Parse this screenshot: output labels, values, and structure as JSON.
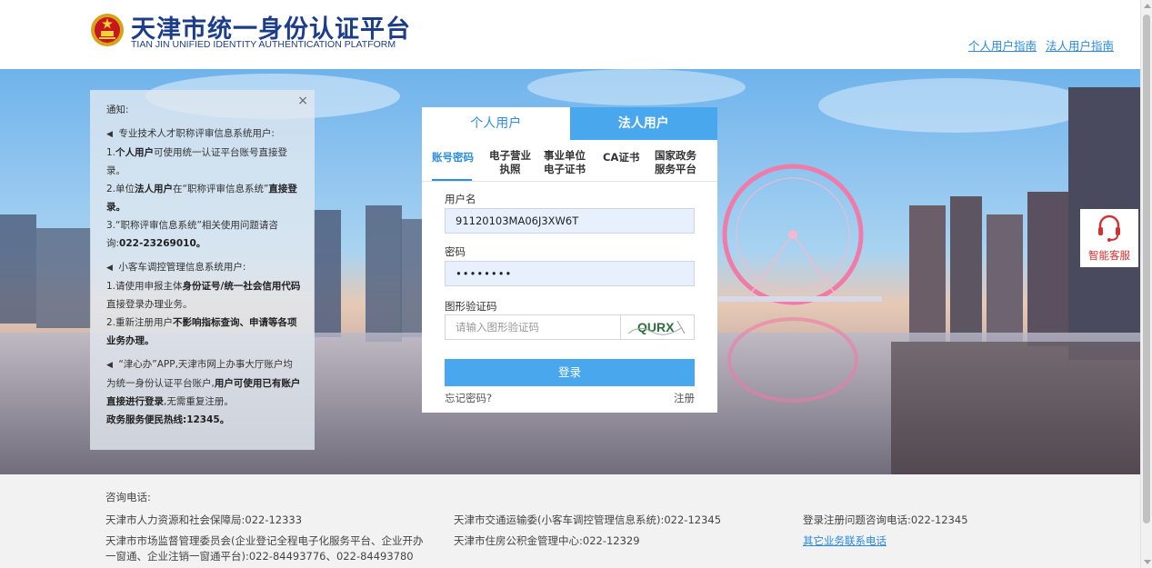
{
  "header": {
    "title_cn": "天津市统一身份认证平台",
    "title_en": "TIAN JIN UNIFIED IDENTITY AUTHENTICATION PLATFORM",
    "links": [
      "个人用户指南",
      "法人用户指南"
    ]
  },
  "notice": {
    "close": "×",
    "title": "通知:",
    "s1_head": "专业技术人才职称评审信息系统用户:",
    "s1_l1a": "1.",
    "s1_l1b": "个人用户",
    "s1_l1c": "可使用统一认证平台账号直接登录。",
    "s1_l2a": "2.单位",
    "s1_l2b": "法人用户",
    "s1_l2c": "在“职称评审信息系统”",
    "s1_l2d": "直接登录。",
    "s1_l3a": "3.“职称评审信息系统”相关使用问题请咨询:",
    "s1_l3b": "022-23269010。",
    "s2_head": "小客车调控管理信息系统用户:",
    "s2_l1a": "1.请使用申报主体",
    "s2_l1b": "身份证号/统一社会信用代码",
    "s2_l1c": "直接登录办理业务。",
    "s2_l2a": "2.重新注册用户",
    "s2_l2b": "不影响指标查询、申请等各项业务办理。",
    "s3_a": "“津心办”APP,天津市网上办事大厅账户均为统一身份认证平台账户,",
    "s3_b": "用户可使用已有账户直接进行登录",
    "s3_c": ",无需重复注册。",
    "s3_d": "政务服务便民热线:12345。"
  },
  "login": {
    "tabs": [
      "个人用户",
      "法人用户"
    ],
    "methods": [
      "账号密码",
      "电子营业\n执照",
      "事业单位\n电子证书",
      "CA证书",
      "国家政务\n服务平台"
    ],
    "username_label": "用户名",
    "username_value": "91120103MA06J3XW6T",
    "password_label": "密码",
    "password_value": "••••••••",
    "captcha_label": "图形验证码",
    "captcha_placeholder": "请输入图形验证码",
    "captcha_text": "QURX",
    "submit": "登录",
    "forgot": "忘记密码?",
    "register": "注册"
  },
  "service": {
    "label": "智能客服"
  },
  "footer": {
    "title": "咨询电话:",
    "c1": [
      "天津市人力资源和社会保障局:022-12333",
      "天津市市场监督管理委员会(企业登记全程电子化服务平台、企业开办",
      "一窗通、企业注销一窗通平台):022-84493776、022-84493780"
    ],
    "c2": [
      "天津市交通运输委(小客车调控管理信息系统):022-12345",
      "天津市住房公积金管理中心:022-12329"
    ],
    "c3": [
      "登录注册问题咨询电话:022-12345",
      "其它业务联系电话"
    ]
  },
  "colors": {
    "brand": "#1b3d8a",
    "accent": "#49a7ee",
    "link": "#2a8be0",
    "service": "#d43030"
  }
}
